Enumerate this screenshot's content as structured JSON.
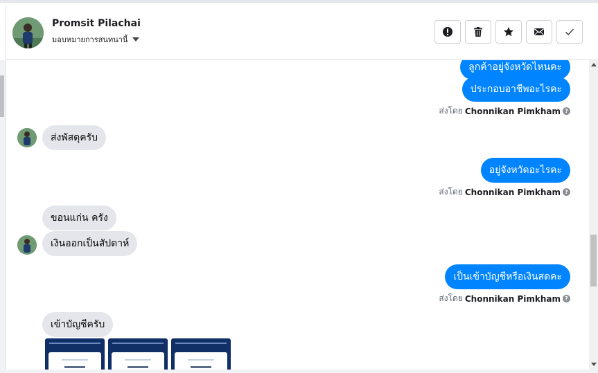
{
  "header": {
    "contact_name": "Promsit Pilachai",
    "assign_label": "มอบหมายการสนทนานี้",
    "actions": [
      {
        "name": "mark-spam-button",
        "icon": "alert-icon"
      },
      {
        "name": "delete-button",
        "icon": "trash-icon"
      },
      {
        "name": "star-button",
        "icon": "star-icon"
      },
      {
        "name": "mark-unread-button",
        "icon": "envelope-icon"
      },
      {
        "name": "mark-done-button",
        "icon": "check-icon"
      }
    ]
  },
  "thread": {
    "sent_by_prefix": "ส่งโดย",
    "agent_name": "Chonnikan Pimkham",
    "messages": {
      "out_1": "ลูกค้าอยู่จังหวัดไหนคะ",
      "out_2": "ประกอบอาชีพอะไรคะ",
      "in_1": "ส่งพัสดุครับ",
      "out_3": "อยู่จังหวัดอะไรคะ",
      "in_2": "ขอนแก่น ครัง",
      "in_3": "เงินออกเป็นสัปดาห์",
      "out_4": "เป็นเข้าบัญชีหรือเงินสดคะ",
      "in_4": "เข้าบัญชีครับ"
    }
  },
  "colors": {
    "outgoing_bubble": "#0084ff",
    "incoming_bubble": "#e4e6eb"
  }
}
